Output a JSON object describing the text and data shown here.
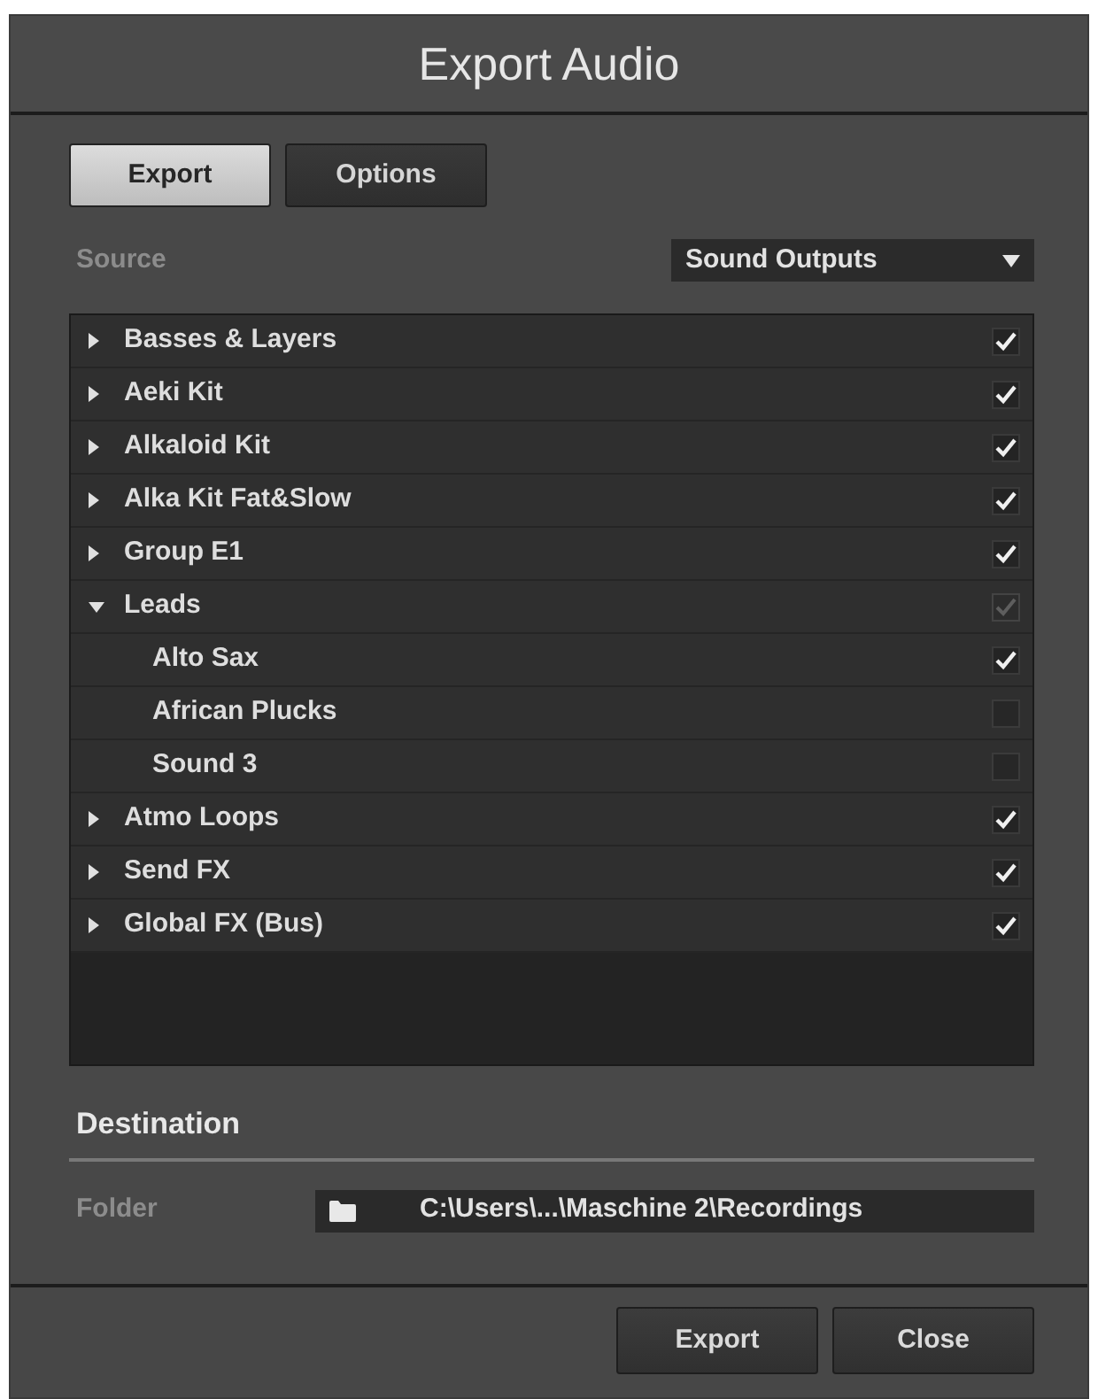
{
  "window": {
    "title": "Export Audio"
  },
  "tabs": [
    {
      "label": "Export",
      "selected": true
    },
    {
      "label": "Options",
      "selected": false
    }
  ],
  "source": {
    "label": "Source",
    "value": "Sound Outputs"
  },
  "outputs": [
    {
      "name": "Basses & Layers",
      "expanded": false,
      "checked": true,
      "mixed": false
    },
    {
      "name": "Aeki Kit",
      "expanded": false,
      "checked": true,
      "mixed": false
    },
    {
      "name": "Alkaloid Kit",
      "expanded": false,
      "checked": true,
      "mixed": false
    },
    {
      "name": "Alka Kit Fat&Slow",
      "expanded": false,
      "checked": true,
      "mixed": false
    },
    {
      "name": "Group E1",
      "expanded": false,
      "checked": true,
      "mixed": false
    },
    {
      "name": "Leads",
      "expanded": true,
      "checked": true,
      "mixed": true,
      "children": [
        {
          "name": "Alto Sax",
          "checked": true
        },
        {
          "name": "African Plucks",
          "checked": false
        },
        {
          "name": "Sound 3",
          "checked": false
        }
      ]
    },
    {
      "name": "Atmo Loops",
      "expanded": false,
      "checked": true,
      "mixed": false
    },
    {
      "name": "Send FX",
      "expanded": false,
      "checked": true,
      "mixed": false
    },
    {
      "name": "Global FX (Bus)",
      "expanded": false,
      "checked": true,
      "mixed": false
    }
  ],
  "destination": {
    "heading": "Destination",
    "folder_label": "Folder",
    "folder_path": "C:\\Users\\...\\Maschine 2\\Recordings"
  },
  "buttons": [
    {
      "label": "Export"
    },
    {
      "label": "Close"
    }
  ]
}
